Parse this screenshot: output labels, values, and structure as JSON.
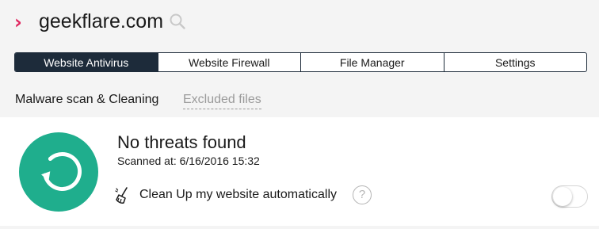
{
  "header": {
    "domain": "geekflare.com",
    "icons": {
      "chevron": "chevron-right-icon",
      "search": "search-icon"
    },
    "chevron_glyph": "›"
  },
  "tabs": [
    {
      "label": "Website Antivirus",
      "active": true
    },
    {
      "label": "Website Firewall",
      "active": false
    },
    {
      "label": "File Manager",
      "active": false
    },
    {
      "label": "Settings",
      "active": false
    }
  ],
  "subnav": {
    "malware": "Malware scan & Cleaning",
    "excluded": "Excluded files"
  },
  "status": {
    "title": "No threats found",
    "scanned": "Scanned at: 6/16/2016 15:32",
    "icon": "refresh-icon",
    "color": "#1fae8d"
  },
  "cleanup": {
    "label": "Clean Up my website automatically",
    "help_glyph": "?",
    "enabled": false
  },
  "colors": {
    "accent": "#e0245e",
    "tab_active": "#1d2b3a",
    "success": "#1fae8d"
  }
}
